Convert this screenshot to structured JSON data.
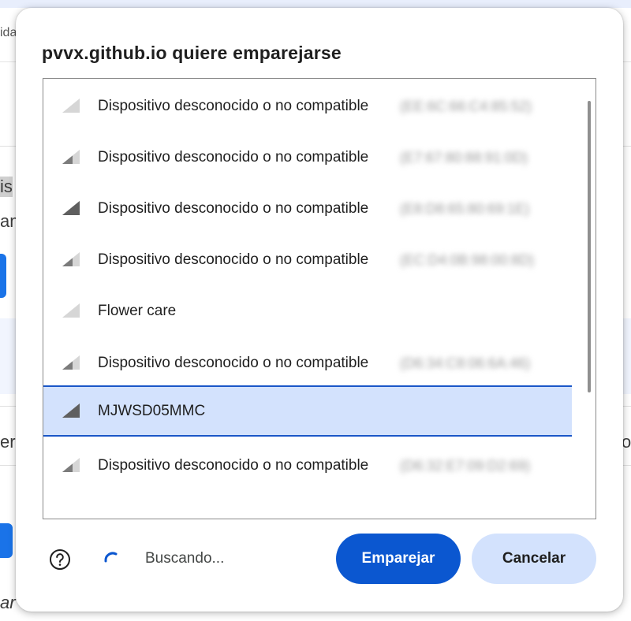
{
  "background_page": {
    "fragments": [
      "ida",
      "is",
      "am",
      "eri",
      "ar",
      "o"
    ]
  },
  "dialog": {
    "title": "pvvx.github.io quiere emparejarse",
    "devices": [
      {
        "label": "Dispositivo desconocido o no compatible",
        "id": "(EE:6C:66:C4:85:52)",
        "signal": "weak",
        "selected": false
      },
      {
        "label": "Dispositivo desconocido o no compatible",
        "id": "(E7:67:80:88:91:0D)",
        "signal": "medium",
        "selected": false
      },
      {
        "label": "Dispositivo desconocido o no compatible",
        "id": "(E8:D8:65:80:69:1E)",
        "signal": "strong",
        "selected": false
      },
      {
        "label": "Dispositivo desconocido o no compatible",
        "id": "(EC:D4:0B:98:00:8D)",
        "signal": "medium",
        "selected": false
      },
      {
        "label": "Flower care",
        "id": "",
        "signal": "weak",
        "selected": false
      },
      {
        "label": "Dispositivo desconocido o no compatible",
        "id": "(D6:34:C8:06:6A:46)",
        "signal": "medium",
        "selected": false
      },
      {
        "label": "MJWSD05MMC",
        "id": "",
        "signal": "strong",
        "selected": true
      },
      {
        "label": "Dispositivo desconocido o no compatible",
        "id": "(D6:32:E7:09:D2:69)",
        "signal": "medium",
        "selected": false
      }
    ],
    "status_text": "Buscando...",
    "pair_button": "Emparejar",
    "cancel_button": "Cancelar",
    "icons": {
      "help": "help-circle-icon",
      "spinner": "loading-spinner-icon",
      "signal": "signal-strength-icon"
    },
    "colors": {
      "primary": "#0b57d0",
      "selection": "#d3e2fd",
      "selection_border": "#1a56c8"
    }
  }
}
